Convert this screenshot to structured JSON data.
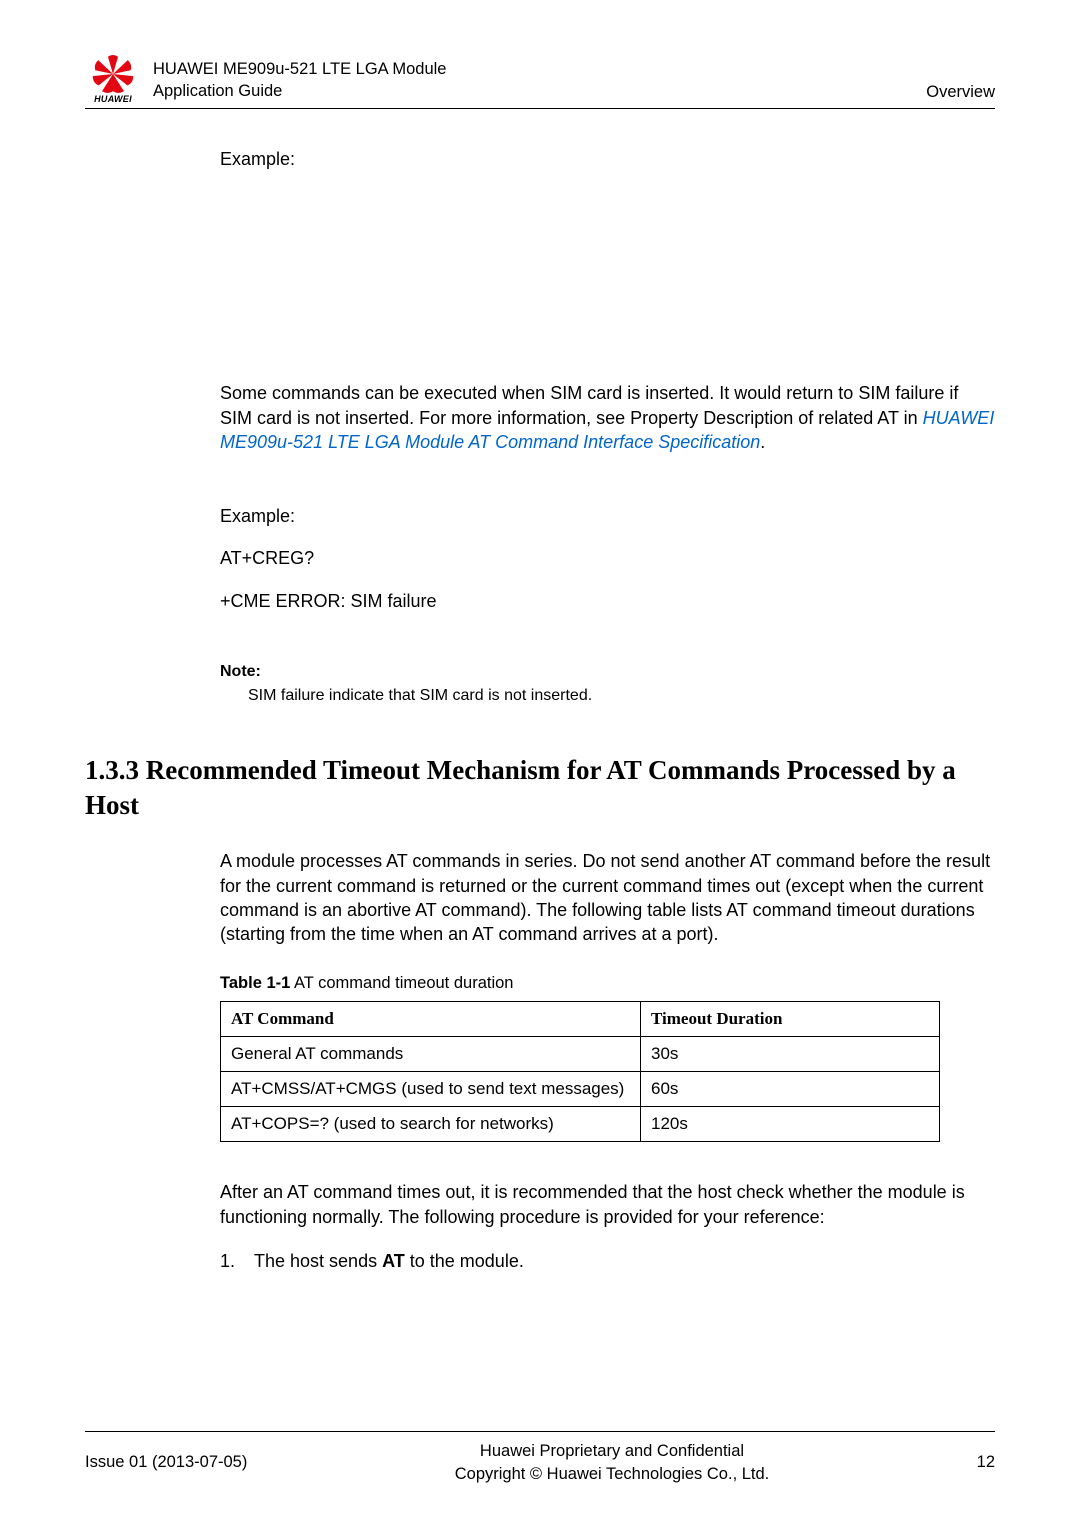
{
  "header": {
    "logo_text": "HUAWEI",
    "title_line1": "HUAWEI ME909u-521 LTE LGA Module",
    "title_line2": "Application Guide",
    "right": "Overview"
  },
  "body": {
    "example1_label": "Example:",
    "para_sim": "Some commands can be executed when SIM card is inserted. It would return to SIM failure if SIM card is not inserted. For more information, see Property Description of related AT in ",
    "link_text": "HUAWEI ME909u-521 LTE LGA Module AT Command Interface Specification",
    "period": ".",
    "example2_label": "Example:",
    "cmd1": "AT+CREG?",
    "cmd2": "+CME ERROR: SIM failure",
    "note_label": "Note:",
    "note_text": "SIM failure indicate that SIM card is not inserted.",
    "section_heading": "1.3.3 Recommended Timeout Mechanism for AT Commands Processed by a Host",
    "para_timeout": "A module processes AT commands in series. Do not send another AT command before the result for the current command is returned or the current command times out (except when the current command is an abortive AT command). The following table lists AT command timeout durations (starting from the time when an AT command arrives at a port).",
    "table_caption_bold": "Table 1-1",
    "table_caption_rest": "  AT command timeout duration",
    "table": {
      "headers": [
        "AT Command",
        "Timeout Duration"
      ],
      "rows": [
        [
          "General AT commands",
          "30s"
        ],
        [
          "AT+CMSS/AT+CMGS (used to send text messages)",
          "60s"
        ],
        [
          "AT+COPS=? (used to search for networks)",
          "120s"
        ]
      ]
    },
    "para_after": "After an AT command times out, it is recommended that the host check whether the module is functioning normally. The following procedure is provided for your reference:",
    "list1_num": "1.",
    "list1_pre": "The host sends ",
    "list1_bold": "AT",
    "list1_post": " to the module."
  },
  "footer": {
    "left": "Issue 01 (2013-07-05)",
    "center_line1": "Huawei Proprietary and Confidential",
    "center_line2": "Copyright © Huawei Technologies Co., Ltd.",
    "right": "12"
  }
}
